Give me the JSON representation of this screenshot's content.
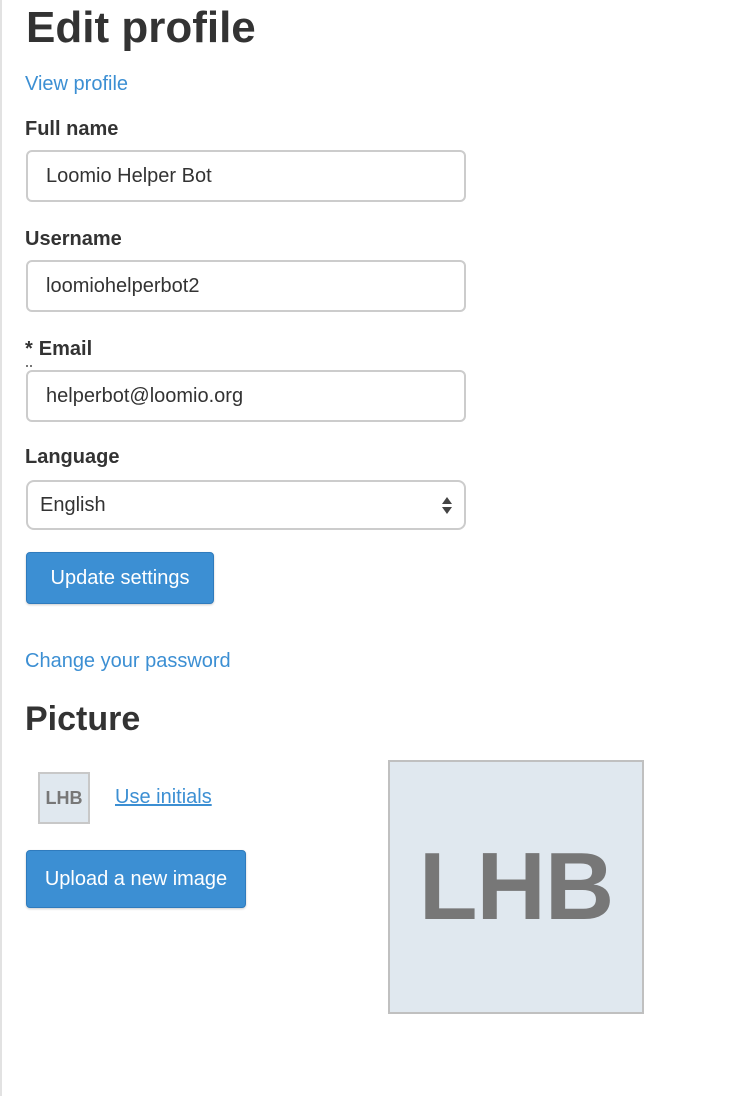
{
  "page": {
    "title": "Edit profile",
    "view_profile_link": "View profile"
  },
  "form": {
    "full_name": {
      "label": "Full name",
      "value": "Loomio Helper Bot"
    },
    "username": {
      "label": "Username",
      "value": "loomiohelperbot2"
    },
    "email": {
      "required_mark": "*",
      "label": "Email",
      "value": "helperbot@loomio.org"
    },
    "language": {
      "label": "Language",
      "selected": "English"
    },
    "update_button": "Update settings",
    "change_password_link": "Change your password"
  },
  "picture": {
    "title": "Picture",
    "initials": "LHB",
    "use_initials_link": "Use initials",
    "upload_button": "Upload a new image"
  },
  "colors": {
    "accent": "#3c8fd3",
    "text": "#333333",
    "avatar_bg": "#e0e8ef",
    "avatar_text": "#777777"
  }
}
